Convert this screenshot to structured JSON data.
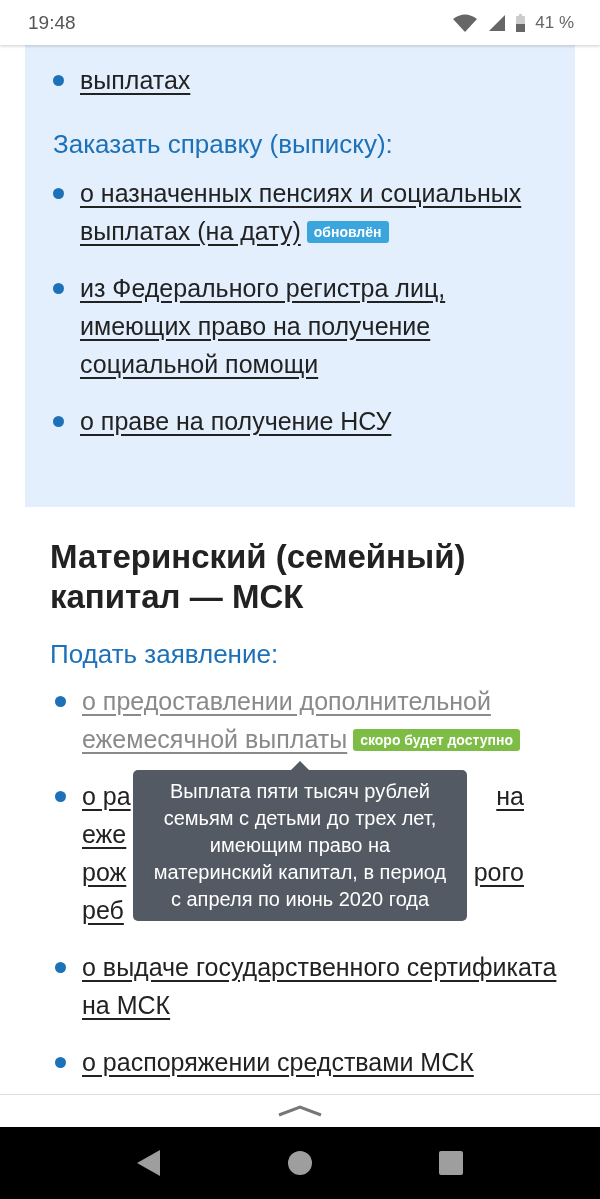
{
  "status_bar": {
    "time": "19:48",
    "battery": "41 %"
  },
  "info_panel": {
    "top_items": [
      {
        "text": "выплатах",
        "disabled": false
      }
    ],
    "heading": "Заказать справку (выписку):",
    "items": [
      {
        "text": "о назначенных пенсиях и социальных выплатах (на дату)",
        "disabled": false,
        "badge": {
          "text": "обновлён",
          "color": "#3aa6dd"
        }
      },
      {
        "text": "из Федерального регистра лиц, имеющих право на получение социальной помощи",
        "disabled": false
      },
      {
        "text": "о праве на получение НСУ",
        "disabled": false
      }
    ]
  },
  "section": {
    "title": "Материнский (семейный) капитал — МСК",
    "subheading": "Подать заявление:",
    "items": [
      {
        "text": "о предоставлении дополнительной ежемесячной выплаты",
        "disabled": true,
        "badge": {
          "text": "скоро будет доступно",
          "color": "#7dbd45"
        }
      },
      {
        "kind": "covered",
        "disabled": false,
        "lines": [
          [
            "о ра",
            "на"
          ],
          [
            "еже"
          ],
          [
            "рож",
            "рого"
          ],
          [
            "реб"
          ]
        ]
      },
      {
        "text": "о выдаче государственного сертификата на МСК",
        "disabled": false
      },
      {
        "text": "о распоряжении средствами МСК",
        "disabled": false
      }
    ],
    "tooltip": "Выплата пяти тысяч рублей семьям с детьми до трех лет, имеющим право на материнский капитал, в период с апреля по июнь 2020 года"
  }
}
